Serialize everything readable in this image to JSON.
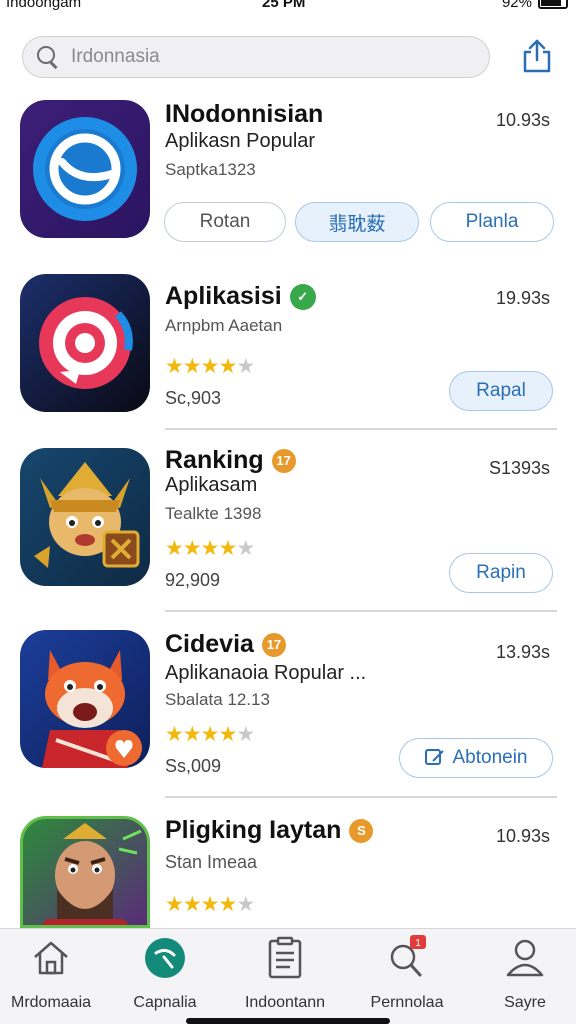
{
  "status_bar": {
    "carrier": "Indoongam",
    "time": "25 PM",
    "battery": "92%"
  },
  "search": {
    "placeholder": "Irdonnasia"
  },
  "apps": [
    {
      "title": "INodonnisian",
      "subtitle": "Aplikasn Popular",
      "detail": "Saptka1323",
      "price": "10.93s",
      "badge": null,
      "rating": null,
      "buttons": [
        "Rotan",
        "翡耽薮",
        "Planla"
      ]
    },
    {
      "title": "Aplikasisi",
      "subtitle": "Arnpbm Aaetan",
      "detail": "",
      "price": "19.93s",
      "badge": {
        "text": "✓",
        "color": "#39a84a"
      },
      "rating": {
        "filled": 4,
        "total": 5
      },
      "count": "Sc,903",
      "buttons": [
        "Rapal"
      ]
    },
    {
      "title": "Ranking",
      "subtitle": "Aplikasam",
      "detail": "Tealkte 1398",
      "price": "S1393s",
      "badge": {
        "text": "17",
        "color": "#e79a2b"
      },
      "rating": {
        "filled": 4,
        "total": 5
      },
      "count": "92,909",
      "buttons": [
        "Rapin"
      ]
    },
    {
      "title": "Cidevia",
      "subtitle": "Aplikanaoia Ropular ...",
      "detail": "Sbalata 12.13",
      "price": "13.93s",
      "badge": {
        "text": "17",
        "color": "#e79a2b"
      },
      "rating": {
        "filled": 4,
        "total": 5
      },
      "count": "Ss,009",
      "buttons": [
        "Abtonein"
      ]
    },
    {
      "title": "Pligking Iaytan",
      "subtitle": "Stan Imeaa",
      "detail": "",
      "price": "10.93s",
      "badge": {
        "text": "S",
        "color": "#e79a2b"
      },
      "rating": {
        "filled": 4,
        "total": 5
      },
      "count": "",
      "buttons": []
    }
  ],
  "tabs": [
    {
      "label": "Mrdomaaia",
      "icon": "home-icon"
    },
    {
      "label": "Capnalia",
      "icon": "apps-icon"
    },
    {
      "label": "Indoontann",
      "icon": "list-icon"
    },
    {
      "label": "Pernnolaa",
      "icon": "search-icon",
      "badge": "1"
    },
    {
      "label": "Sayre",
      "icon": "person-icon"
    }
  ],
  "colors": {
    "accent": "#2a6fb5",
    "star": "#f2b80c",
    "tabbar_bg": "#f4f4f6"
  }
}
